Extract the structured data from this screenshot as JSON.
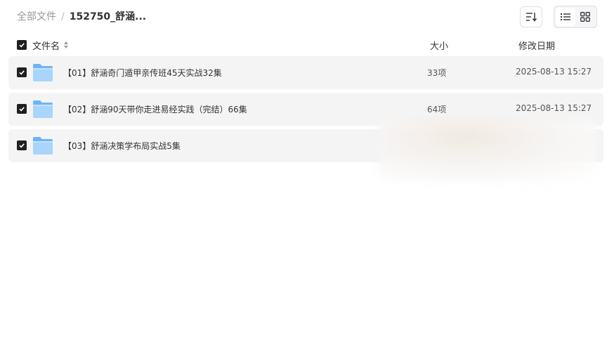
{
  "breadcrumb": {
    "root": "全部文件",
    "separator": "/",
    "current": "152750_舒涵..."
  },
  "toolbar": {
    "sort_icon": "sort-icon",
    "list_view_icon": "list-view-icon",
    "grid_view_icon": "grid-view-icon",
    "active_view": "list"
  },
  "columns": {
    "name": "文件名",
    "size": "大小",
    "modified": "修改日期"
  },
  "rows": [
    {
      "name": "【01】舒涵奇门遁甲亲传班45天实战32集",
      "size": "33项",
      "modified": "2025-08-13 15:27",
      "checked": true
    },
    {
      "name": "【02】舒涵90天带你走进易经实践（完结）66集",
      "size": "64项",
      "modified": "2025-08-13 15:27",
      "checked": true
    },
    {
      "name": "【03】舒涵决策学布局实战5集",
      "size": "",
      "modified": "",
      "checked": true
    }
  ],
  "colors": {
    "row_bg": "#f4f4f5",
    "checkbox": "#1f1f1f",
    "folder_light": "#a9d4fb",
    "folder_dark": "#6fb3f5"
  }
}
